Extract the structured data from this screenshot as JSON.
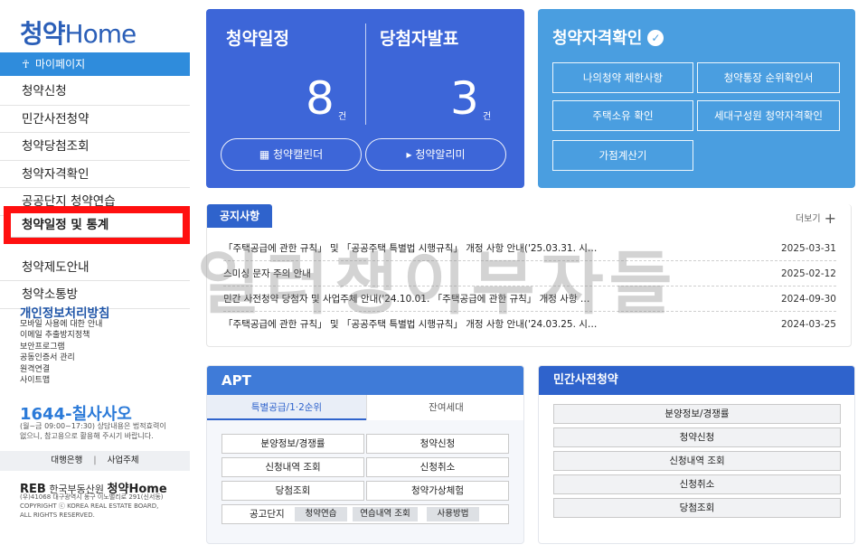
{
  "sidebar": {
    "logo_prefix": "청약",
    "logo_suffix": "Home",
    "mypage": "마이페이지",
    "menu": [
      "청약신청",
      "민간사전청약",
      "청약당첨조회",
      "청약자격확인",
      "공공단지 청약연습"
    ],
    "highlighted": "청약일정 및 통계",
    "menu_after": [
      "청약제도안내",
      "청약소통방"
    ],
    "privacy_title": "개인정보처리방침",
    "privacy_links": [
      "모바일 사용에 대한 안내",
      "이메일 추출방지정책",
      "보안프로그램",
      "공동인증서 관리",
      "원격연결",
      "사이트맵"
    ],
    "phone": "1644-칠사사오",
    "phone_note_1": "(월~금 09:00~17:30) 상담내용은 법적효력이",
    "phone_note_2": "없으니, 참고용으로 활용해 주시기 바랍니다.",
    "biz_left": "대행은행",
    "biz_sep": "|",
    "biz_right": "사업주체",
    "footer_logo_a": "REB",
    "footer_logo_b": "한국부동산원",
    "footer_logo_c": "청약Home",
    "footer_line_1": "(우)41068 대구광역시 동구 이노밸리로 291(신서동)",
    "footer_line_2": "COPYRIGHT ⓒ KOREA REAL ESTATE BOARD,",
    "footer_line_3": "ALL RIGHTS RESERVED."
  },
  "schedule": {
    "title_left": "청약일정",
    "title_right": "당첨자발표",
    "count_left": "8",
    "count_right": "3",
    "unit": "건",
    "btn_calendar": "청약캘린더",
    "btn_alert": "청약알리미"
  },
  "qualification": {
    "title": "청약자격확인",
    "buttons": [
      "나의청약 제한사항",
      "청약통장 순위확인서",
      "주택소유 확인",
      "세대구성원 청약자격확인",
      "가점계산기"
    ]
  },
  "notice": {
    "tab": "공지사항",
    "more": "더보기",
    "rows": [
      {
        "title": "「주택공급에 관한 규칙」 및 「공공주택 특별법 시행규칙」 개정 사항 안내('25.03.31. 시…",
        "date": "2025-03-31"
      },
      {
        "title": "스미싱 문자 주의 안내",
        "date": "2025-02-12"
      },
      {
        "title": "민간 사전청약 당첨자 및 사업주체 안내('24.10.01. 「주택공급에 관한 규칙」 개정 사항 …",
        "date": "2024-09-30"
      },
      {
        "title": "「주택공급에 관한 규칙」 및 「공공주택 특별법 시행규칙」 개정 사항 안내('24.03.25. 시…",
        "date": "2024-03-25"
      }
    ],
    "watermark": "일러챙이부자들"
  },
  "apt": {
    "title": "APT",
    "tab_on": "특별공급/1·2순위",
    "tab_off": "잔여세대",
    "buttons": [
      "분양정보/경쟁률",
      "청약신청",
      "신청내역 조회",
      "신청취소",
      "당첨조회",
      "청약가상체험"
    ],
    "gong_label": "공고단지",
    "chips": [
      "청약연습",
      "연습내역 조회",
      "사용방법"
    ]
  },
  "private": {
    "title": "민간사전청약",
    "buttons": [
      "분양정보/경쟁률",
      "청약신청",
      "신청내역 조회",
      "신청취소",
      "당첨조회"
    ]
  }
}
